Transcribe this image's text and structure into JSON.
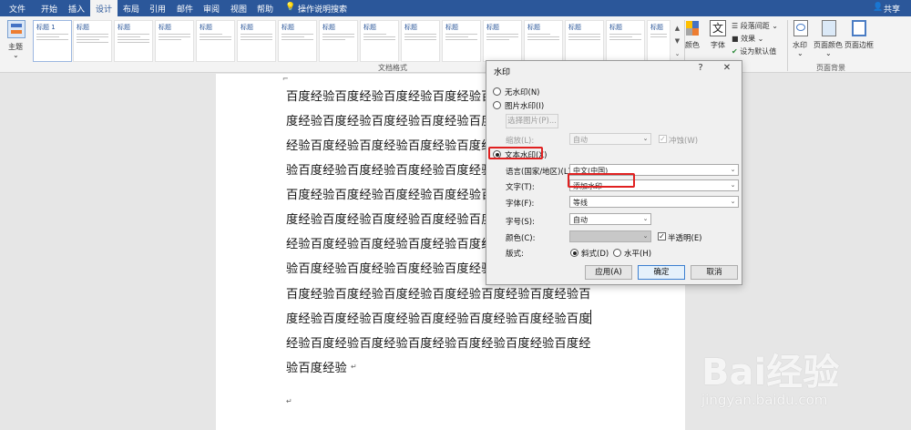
{
  "tabs": [
    "文件",
    "开始",
    "插入",
    "设计",
    "布局",
    "引用",
    "邮件",
    "审阅",
    "视图",
    "帮助"
  ],
  "tell_me": "操作说明搜索",
  "share": "共享",
  "ribbon": {
    "theme_label": "主题",
    "gallery_first_title": "标题 1",
    "gallery_titles": [
      "标题",
      "标题",
      "标题",
      "标题",
      "标题",
      "标题",
      "标题",
      "标题",
      "标题",
      "标题",
      "标题",
      "标题",
      "标题",
      "标题",
      "标题"
    ],
    "gallery_group": "文档格式",
    "colors_label": "颜色",
    "fonts_label": "字体",
    "paragraph_spacing": "段落间距",
    "effects": "效果",
    "set_default": "设为默认值",
    "watermark_label": "水印",
    "page_color_label": "页面颜色",
    "page_border_label": "页面边框",
    "page_bg_group": "页面背景"
  },
  "document": {
    "lines": [
      "百度经验百度经验百度经验百度经验百度",
      "度经验百度经验百度经验百度经验百度经",
      "经验百度经验百度经验百度经验百度经验",
      "验百度经验百度经验百度经验百度经验百",
      "百度经验百度经验百度经验百度经验百度",
      "度经验百度经验百度经验百度经验百度经",
      "经验百度经验百度经验百度经验百度经验",
      "验百度经验百度经验百度经验百度经验百",
      "百度经验百度经验百度经验百度经验百度经验百度经验百",
      "度经验百度经验百度经验百度经验百度经验百度经验百度",
      "经验百度经验百度经验百度经验百度经验百度经验百度经",
      "验百度经验"
    ]
  },
  "dialog": {
    "title": "水印",
    "help": "?",
    "close": "✕",
    "no_watermark": "无水印(N)",
    "picture_watermark": "图片水印(I)",
    "select_picture": "选择图片(P)...",
    "scale_label": "缩放(L):",
    "scale_value": "自动",
    "washout": "冲蚀(W)",
    "text_watermark": "文本水印(X)",
    "language_label": "语言(国家/地区)(L):",
    "language_value": "中文(中国)",
    "text_label": "文字(T):",
    "text_value": "添加水印",
    "font_label": "字体(F):",
    "font_value": "等线",
    "size_label": "字号(S):",
    "size_value": "自动",
    "color_label": "颜色(C):",
    "semitransparent": "半透明(E)",
    "layout_label": "版式:",
    "diagonal": "斜式(D)",
    "horizontal": "水平(H)",
    "apply": "应用(A)",
    "ok": "确定",
    "cancel": "取消"
  },
  "watermark_brand": "Bai经验",
  "watermark_url": "jingyan.baidu.com"
}
